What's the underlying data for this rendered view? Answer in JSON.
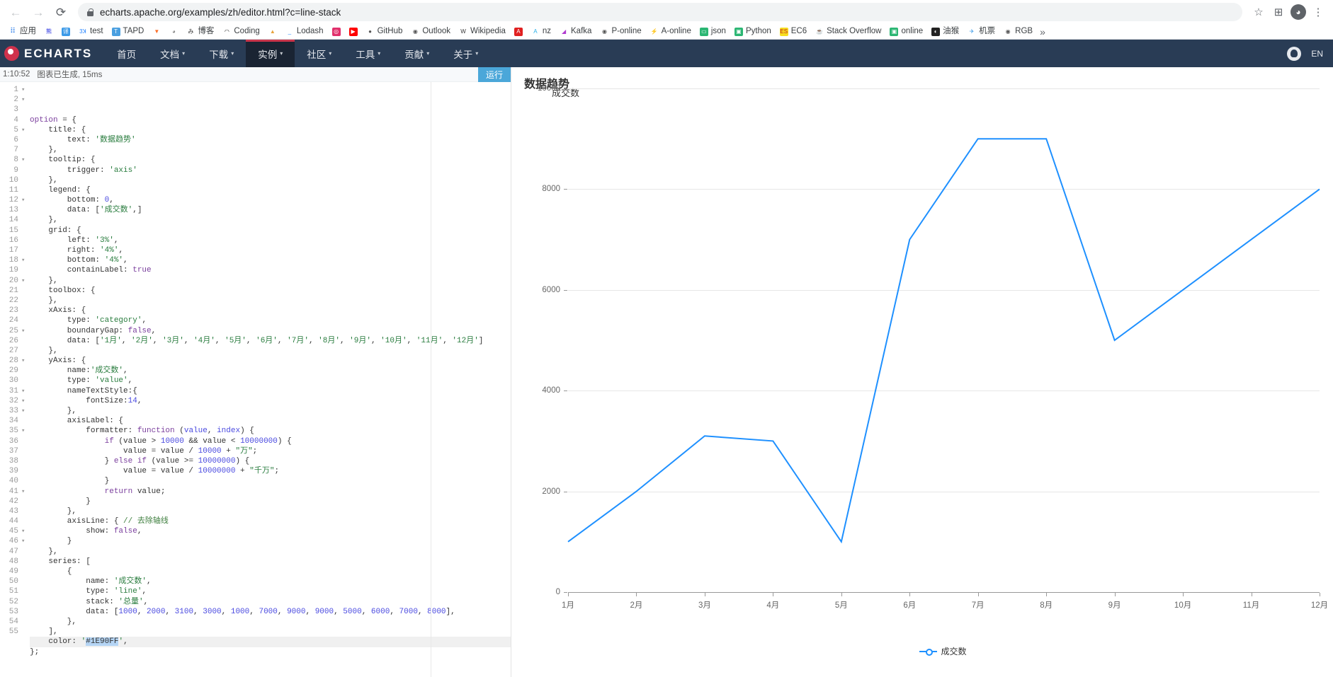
{
  "browser": {
    "back_icon": "←",
    "forward_icon": "→",
    "reload_icon": "⟳",
    "url": "echarts.apache.org/examples/zh/editor.html?c=line-stack",
    "star_icon": "☆",
    "extensions_icon": "⊞",
    "profile_icon": "●",
    "menu_icon": "⋮",
    "bookmarks": [
      {
        "label": "应用",
        "icon": "apps-grid-icon",
        "glyph": "⠿",
        "color": "#ffffff",
        "fg": "#1a73e8"
      },
      {
        "label": "",
        "icon": "baidu-icon",
        "glyph": "熊",
        "color": "#ffffff",
        "fg": "#2932e1"
      },
      {
        "label": "",
        "icon": "translate-icon",
        "glyph": "译",
        "color": "#3c9ae8",
        "fg": "#ffffff"
      },
      {
        "label": "test",
        "icon": "jira-icon",
        "glyph": "3ꓘ",
        "color": "#ffffff",
        "fg": "#2684ff"
      },
      {
        "label": "TAPD",
        "icon": "tapd-icon",
        "glyph": "T",
        "color": "#4a9fe0",
        "fg": "#ffffff"
      },
      {
        "label": "",
        "icon": "gitlab-icon",
        "glyph": "▼",
        "color": "#ffffff",
        "fg": "#fc6d26"
      },
      {
        "label": "",
        "icon": "avatar-icon",
        "glyph": "◕",
        "color": "#ffffff",
        "fg": "#888888"
      },
      {
        "label": "博客",
        "icon": "blog-icon",
        "glyph": "み",
        "color": "#ffffff",
        "fg": "#333333"
      },
      {
        "label": "Coding",
        "icon": "coding-icon",
        "glyph": "◠",
        "color": "#ffffff",
        "fg": "#222222"
      },
      {
        "label": "",
        "icon": "flame-icon",
        "glyph": "▲",
        "color": "#ffffff",
        "fg": "#e8a33d"
      },
      {
        "label": "Lodash",
        "icon": "lodash-icon",
        "glyph": "_",
        "color": "#ffffff",
        "fg": "#3492ff"
      },
      {
        "label": "",
        "icon": "instagram-icon",
        "glyph": "◎",
        "color": "#e1306c",
        "fg": "#ffffff"
      },
      {
        "label": "",
        "icon": "youtube-icon",
        "glyph": "▶",
        "color": "#ff0000",
        "fg": "#ffffff"
      },
      {
        "label": "GitHub",
        "icon": "github-icon",
        "glyph": "●",
        "color": "#ffffff",
        "fg": "#555555"
      },
      {
        "label": "Outlook",
        "icon": "globe-icon",
        "glyph": "◉",
        "color": "#ffffff",
        "fg": "#555555"
      },
      {
        "label": "Wikipedia",
        "icon": "wikipedia-icon",
        "glyph": "W",
        "color": "#ffffff",
        "fg": "#333333"
      },
      {
        "label": "",
        "icon": "adobe-icon",
        "glyph": "A",
        "color": "#e02020",
        "fg": "#ffffff"
      },
      {
        "label": "nz",
        "icon": "nz-icon",
        "glyph": "A",
        "color": "#ffffff",
        "fg": "#2ab0e8"
      },
      {
        "label": "Kafka",
        "icon": "kafka-icon",
        "glyph": "◢",
        "color": "#ffffff",
        "fg": "#b03ad0"
      },
      {
        "label": "P-online",
        "icon": "globe-icon",
        "glyph": "◉",
        "color": "#ffffff",
        "fg": "#555555"
      },
      {
        "label": "A-online",
        "icon": "bolt-icon",
        "glyph": "⚡",
        "color": "#ffffff",
        "fg": "#2a7df5"
      },
      {
        "label": "json",
        "icon": "json-icon",
        "glyph": "▭",
        "color": "#2bb673",
        "fg": "#ffffff"
      },
      {
        "label": "Python",
        "icon": "python-icon",
        "glyph": "▣",
        "color": "#2bb673",
        "fg": "#ffffff"
      },
      {
        "label": "EC6",
        "icon": "es6-icon",
        "glyph": "ES",
        "color": "#f7df1e",
        "fg": "#c02020"
      },
      {
        "label": "Stack Overflow",
        "icon": "java-icon",
        "glyph": "☕",
        "color": "#ffffff",
        "fg": "#5382a1"
      },
      {
        "label": "online",
        "icon": "online-icon",
        "glyph": "▣",
        "color": "#2bb673",
        "fg": "#ffffff"
      },
      {
        "label": "油猴",
        "icon": "tampermonkey-icon",
        "glyph": "◐",
        "color": "#222222",
        "fg": "#ffffff"
      },
      {
        "label": "机票",
        "icon": "flight-icon",
        "glyph": "✈",
        "color": "#ffffff",
        "fg": "#3c9ae8"
      },
      {
        "label": "RGB",
        "icon": "globe-icon",
        "glyph": "◉",
        "color": "#ffffff",
        "fg": "#555555"
      }
    ],
    "bookmarks_overflow": "»"
  },
  "site": {
    "logo_text": "ECHARTS",
    "nav": [
      {
        "label": "首页",
        "has_caret": false,
        "active": false
      },
      {
        "label": "文档",
        "has_caret": true,
        "active": false
      },
      {
        "label": "下载",
        "has_caret": true,
        "active": false
      },
      {
        "label": "实例",
        "has_caret": true,
        "active": true
      },
      {
        "label": "社区",
        "has_caret": true,
        "active": false
      },
      {
        "label": "工具",
        "has_caret": true,
        "active": false
      },
      {
        "label": "贡献",
        "has_caret": true,
        "active": false
      },
      {
        "label": "关于",
        "has_caret": true,
        "active": false
      }
    ],
    "caret_glyph": "▾",
    "github_icon": "github-icon",
    "lang": "EN"
  },
  "editor": {
    "status_time": "1:10:52",
    "status_text": "图表已生成, 15ms",
    "run_label": "运行",
    "total_lines": 55,
    "current_line": 53,
    "lines": [
      {
        "n": 1,
        "fold": "▾",
        "html": "<span class=\"tok-key\">option</span> = {"
      },
      {
        "n": 2,
        "fold": "▾",
        "html": "    title: {"
      },
      {
        "n": 3,
        "fold": "",
        "html": "        text: <span class=\"tok-str\">'数据趋势'</span>"
      },
      {
        "n": 4,
        "fold": "",
        "html": "    },"
      },
      {
        "n": 5,
        "fold": "▾",
        "html": "    tooltip: {"
      },
      {
        "n": 6,
        "fold": "",
        "html": "        trigger: <span class=\"tok-str\">'axis'</span>"
      },
      {
        "n": 7,
        "fold": "",
        "html": "    },"
      },
      {
        "n": 8,
        "fold": "▾",
        "html": "    legend: {"
      },
      {
        "n": 9,
        "fold": "",
        "html": "        bottom: <span class=\"tok-num\">0</span>,"
      },
      {
        "n": 10,
        "fold": "",
        "html": "        data: [<span class=\"tok-str\">'成交数'</span>,]"
      },
      {
        "n": 11,
        "fold": "",
        "html": "    },"
      },
      {
        "n": 12,
        "fold": "▾",
        "html": "    grid: {"
      },
      {
        "n": 13,
        "fold": "",
        "html": "        left: <span class=\"tok-str\">'3%'</span>,"
      },
      {
        "n": 14,
        "fold": "",
        "html": "        right: <span class=\"tok-str\">'4%'</span>,"
      },
      {
        "n": 15,
        "fold": "",
        "html": "        bottom: <span class=\"tok-str\">'4%'</span>,"
      },
      {
        "n": 16,
        "fold": "",
        "html": "        containLabel: <span class=\"tok-bool\">true</span>"
      },
      {
        "n": 17,
        "fold": "",
        "html": "    },"
      },
      {
        "n": 18,
        "fold": "▾",
        "html": "    toolbox: {"
      },
      {
        "n": 19,
        "fold": "",
        "html": "    },"
      },
      {
        "n": 20,
        "fold": "▾",
        "html": "    xAxis: {"
      },
      {
        "n": 21,
        "fold": "",
        "html": "        type: <span class=\"tok-str\">'category'</span>,"
      },
      {
        "n": 22,
        "fold": "",
        "html": "        boundaryGap: <span class=\"tok-bool\">false</span>,"
      },
      {
        "n": 23,
        "fold": "",
        "html": "        data: [<span class=\"tok-str\">'1月'</span>, <span class=\"tok-str\">'2月'</span>, <span class=\"tok-str\">'3月'</span>, <span class=\"tok-str\">'4月'</span>, <span class=\"tok-str\">'5月'</span>, <span class=\"tok-str\">'6月'</span>, <span class=\"tok-str\">'7月'</span>, <span class=\"tok-str\">'8月'</span>, <span class=\"tok-str\">'9月'</span>, <span class=\"tok-str\">'10月'</span>, <span class=\"tok-str\">'11月'</span>, <span class=\"tok-str\">'12月'</span>]"
      },
      {
        "n": 24,
        "fold": "",
        "html": "    },"
      },
      {
        "n": 25,
        "fold": "▾",
        "html": "    yAxis: {"
      },
      {
        "n": 26,
        "fold": "",
        "html": "        name:<span class=\"tok-str\">'成交数'</span>,"
      },
      {
        "n": 27,
        "fold": "",
        "html": "        type: <span class=\"tok-str\">'value'</span>,"
      },
      {
        "n": 28,
        "fold": "▾",
        "html": "        nameTextStyle:{"
      },
      {
        "n": 29,
        "fold": "",
        "html": "            fontSize:<span class=\"tok-num\">14</span>,"
      },
      {
        "n": 30,
        "fold": "",
        "html": "        },"
      },
      {
        "n": 31,
        "fold": "▾",
        "html": "        axisLabel: {"
      },
      {
        "n": 32,
        "fold": "▾",
        "html": "            formatter: <span class=\"tok-key\">function</span> (<span class=\"tok-num\">value</span>, <span class=\"tok-num\">index</span>) {"
      },
      {
        "n": 33,
        "fold": "▾",
        "html": "                <span class=\"tok-key\">if</span> (value &gt; <span class=\"tok-num\">10000</span> &amp;&amp; value &lt; <span class=\"tok-num\">10000000</span>) {"
      },
      {
        "n": 34,
        "fold": "",
        "html": "                    value = value / <span class=\"tok-num\">10000</span> + <span class=\"tok-str\">\"万\"</span>;"
      },
      {
        "n": 35,
        "fold": "▾",
        "html": "                } <span class=\"tok-key\">else if</span> (value &gt;= <span class=\"tok-num\">10000000</span>) {"
      },
      {
        "n": 36,
        "fold": "",
        "html": "                    value = value / <span class=\"tok-num\">10000000</span> + <span class=\"tok-str\">\"千万\"</span>;"
      },
      {
        "n": 37,
        "fold": "",
        "html": "                }"
      },
      {
        "n": 38,
        "fold": "",
        "html": "                <span class=\"tok-key\">return</span> value;"
      },
      {
        "n": 39,
        "fold": "",
        "html": "            }"
      },
      {
        "n": 40,
        "fold": "",
        "html": "        },"
      },
      {
        "n": 41,
        "fold": "▾",
        "html": "        axisLine: { <span class=\"tok-com\">// 去除轴线</span>"
      },
      {
        "n": 42,
        "fold": "",
        "html": "            show: <span class=\"tok-bool\">false</span>,"
      },
      {
        "n": 43,
        "fold": "",
        "html": "        }"
      },
      {
        "n": 44,
        "fold": "",
        "html": "    },"
      },
      {
        "n": 45,
        "fold": "▾",
        "html": "    series: ["
      },
      {
        "n": 46,
        "fold": "▾",
        "html": "        {"
      },
      {
        "n": 47,
        "fold": "",
        "html": "            name: <span class=\"tok-str\">'成交数'</span>,"
      },
      {
        "n": 48,
        "fold": "",
        "html": "            type: <span class=\"tok-str\">'line'</span>,"
      },
      {
        "n": 49,
        "fold": "",
        "html": "            stack: <span class=\"tok-str\">'总量'</span>,"
      },
      {
        "n": 50,
        "fold": "",
        "html": "            data: [<span class=\"tok-num\">1000</span>, <span class=\"tok-num\">2000</span>, <span class=\"tok-num\">3100</span>, <span class=\"tok-num\">3000</span>, <span class=\"tok-num\">1000</span>, <span class=\"tok-num\">7000</span>, <span class=\"tok-num\">9000</span>, <span class=\"tok-num\">9000</span>, <span class=\"tok-num\">5000</span>, <span class=\"tok-num\">6000</span>, <span class=\"tok-num\">7000</span>, <span class=\"tok-num\">8000</span>],"
      },
      {
        "n": 51,
        "fold": "",
        "html": "        },"
      },
      {
        "n": 52,
        "fold": "",
        "html": "    ],"
      },
      {
        "n": 53,
        "fold": "",
        "html": "    color: <span class=\"tok-str\">'</span><span class=\"tok-sel\">#1E90FF</span><span class=\"tok-str\">'</span>,"
      },
      {
        "n": 54,
        "fold": "",
        "html": "};"
      },
      {
        "n": 55,
        "fold": "",
        "html": ""
      }
    ]
  },
  "chart_data": {
    "type": "line",
    "title": "数据趋势",
    "xlabel": "",
    "ylabel": "成交数",
    "categories": [
      "1月",
      "2月",
      "3月",
      "4月",
      "5月",
      "6月",
      "7月",
      "8月",
      "9月",
      "10月",
      "11月",
      "12月"
    ],
    "series": [
      {
        "name": "成交数",
        "values": [
          1000,
          2000,
          3100,
          3000,
          1000,
          7000,
          9000,
          9000,
          5000,
          6000,
          7000,
          8000
        ],
        "color": "#1E90FF"
      }
    ],
    "ylim": [
      0,
      10000
    ],
    "yticks": [
      0,
      2000,
      4000,
      6000,
      8000,
      10000
    ],
    "ytick_labels": [
      "0",
      "2000",
      "4000",
      "6000",
      "8000",
      "10000"
    ],
    "grid": true,
    "legend_position": "bottom",
    "legend_entries": [
      "成交数"
    ]
  }
}
